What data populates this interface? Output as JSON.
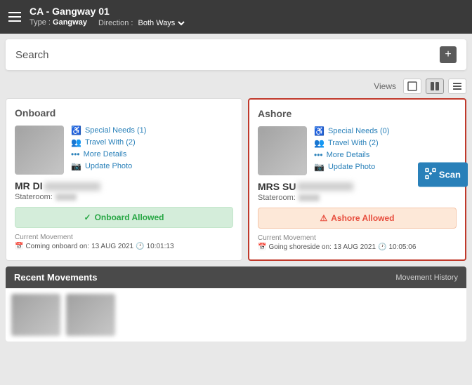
{
  "header": {
    "title": "CA - Gangway 01",
    "type_label": "Type :",
    "type_value": "Gangway",
    "direction_label": "Direction :",
    "direction_value": "Both Ways"
  },
  "search": {
    "label": "Search",
    "plus_label": "+"
  },
  "views": {
    "label": "Views",
    "options": [
      "card-single",
      "card-double",
      "list"
    ]
  },
  "onboard_card": {
    "header": "Onboard",
    "special_needs": "Special Needs (1)",
    "travel_with": "Travel With (2)",
    "more_details": "More Details",
    "update_photo": "Update Photo",
    "name_prefix": "MR DI",
    "stateroom_label": "Stateroom:",
    "status_label": "Onboard Allowed",
    "movement_label": "Current Movement",
    "movement_text": "Coming onboard on:",
    "movement_date": "13 AUG 2021",
    "movement_time": "10:01:13"
  },
  "ashore_card": {
    "header": "Ashore",
    "special_needs": "Special Needs (0)",
    "travel_with": "Travel With (2)",
    "more_details": "More Details",
    "update_photo": "Update Photo",
    "name_prefix": "MRS SU",
    "stateroom_label": "Stateroom:",
    "status_label": "Ashore Allowed",
    "movement_label": "Current Movement",
    "movement_text": "Going shoreside on:",
    "movement_date": "13 AUG 2021",
    "movement_time": "10:05:06"
  },
  "scan_button": {
    "label": "Scan"
  },
  "recent": {
    "title": "Recent Movements",
    "history_label": "Movement History"
  },
  "colors": {
    "header_bg": "#3a3a3a",
    "accent_teal": "#1abc9c",
    "accent_blue": "#2980b9",
    "onboard_green": "#28a745",
    "ashore_red": "#e74c3c"
  }
}
